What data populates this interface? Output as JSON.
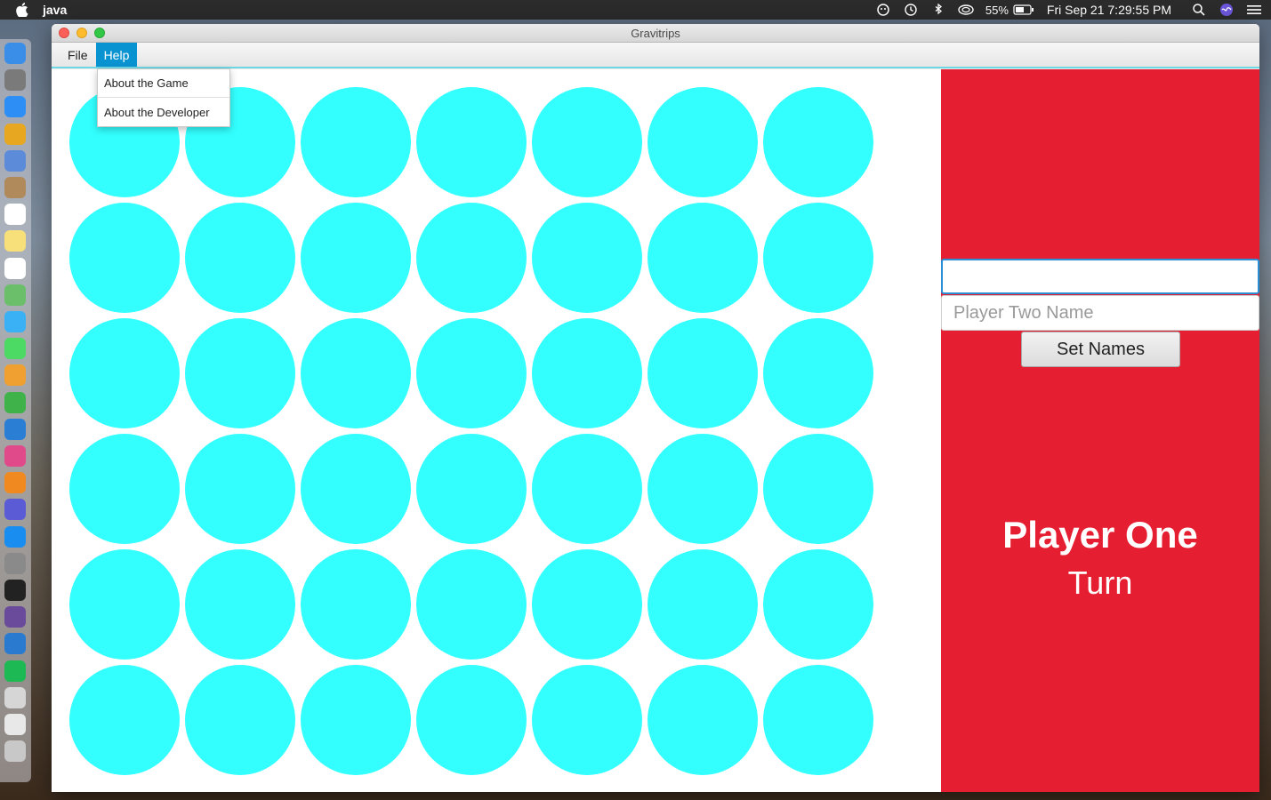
{
  "system_menubar": {
    "app_name": "java",
    "battery": "55%",
    "clock": "Fri Sep 21  7:29:55 PM",
    "icons": [
      "apple-icon",
      "siri-icon",
      "time-machine-icon",
      "bluetooth-icon",
      "airplay-icon",
      "battery-icon",
      "spotlight-icon",
      "siri-colored-icon",
      "control-center-icon"
    ]
  },
  "window": {
    "title": "Gravitrips"
  },
  "app_menu": {
    "items": [
      {
        "label": "File",
        "active": false
      },
      {
        "label": "Help",
        "active": true
      }
    ],
    "help_dropdown": [
      "About the Game",
      "About the Developer"
    ]
  },
  "board": {
    "rows": 6,
    "columns": 7,
    "empty_color": "#33ffff"
  },
  "side_panel": {
    "background": "#e61e32",
    "player_one_value": "",
    "player_two_placeholder": "Player Two Name",
    "set_names_label": "Set Names",
    "turn_player": "Player One",
    "turn_label": "Turn"
  },
  "dock": {
    "icons": [
      "finder-icon",
      "launchpad-icon",
      "safari-icon",
      "chrome-icon",
      "preview-icon",
      "contacts-icon",
      "calendar-icon",
      "notes-icon",
      "reminders-icon",
      "maps-icon",
      "messages-icon",
      "facetime-icon",
      "pages-icon",
      "numbers-icon",
      "keynote-icon",
      "itunes-icon",
      "ibooks-icon",
      "siri-icon",
      "app-store-icon",
      "system-preferences-icon",
      "terminal-icon",
      "github-icon",
      "vscode-icon",
      "pycharm-icon",
      "script-editor-icon",
      "documents-icon",
      "trash-icon"
    ]
  }
}
